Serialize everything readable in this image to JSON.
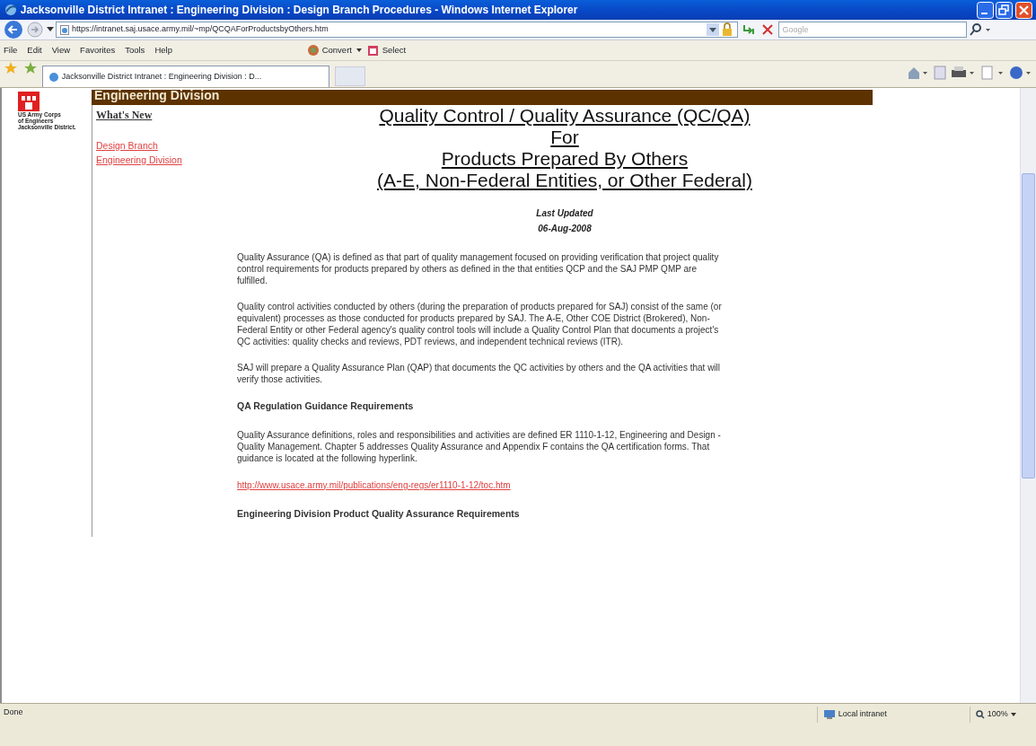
{
  "window": {
    "title": "Jacksonville District Intranet : Engineering Division : Design Branch Procedures - Windows Internet Explorer"
  },
  "address": {
    "url": "https://intranet.saj.usace.army.mil/~mp/QCQAForProductsbyOthers.htm"
  },
  "search": {
    "placeholder": "Google"
  },
  "menu": [
    "File",
    "Edit",
    "View",
    "Favorites",
    "Tools",
    "Help"
  ],
  "toolbar": [
    "Convert",
    "Select"
  ],
  "tabs": [
    {
      "label": "Jacksonville District Intranet : Engineering Division : D...",
      "selected": true
    }
  ],
  "logo": {
    "lines": [
      "US Army Corps",
      "of Engineers",
      "Jacksonville District."
    ]
  },
  "banner": "Engineering Division",
  "sidebar": [
    {
      "label": "What's New",
      "kind": "plain"
    },
    {
      "label": "Design Branch",
      "kind": "red"
    },
    {
      "label": "Engineering Division",
      "kind": "red"
    }
  ],
  "heading": [
    "Quality Control / Quality Assurance (QC/QA)",
    "For",
    "Products Prepared By Others",
    "(A-E, Non-Federal Entities, or Other Federal)"
  ],
  "updated": {
    "label": "Last Updated",
    "date": "06-Aug-2008"
  },
  "body": [
    {
      "kind": "para",
      "text": "Quality Assurance (QA) is defined as that part of quality management focused on providing verification that project quality control requirements for products prepared by others as defined in the that entities QCP and the SAJ PMP QMP are fulfilled."
    },
    {
      "kind": "para",
      "text": "Quality control activities conducted by others (during the preparation of products prepared for SAJ) consist of the same (or equivalent) processes as those conducted for products prepared by SAJ. The A-E, Other COE District (Brokered), Non-Federal Entity or other Federal agency's quality control tools will include a Quality Control Plan that documents a project's QC activities: quality checks and reviews, PDT reviews, and independent technical reviews (ITR)."
    },
    {
      "kind": "para",
      "text": "SAJ will prepare a Quality Assurance Plan (QAP) that documents the QC activities by others and the QA activities that will verify those activities."
    },
    {
      "kind": "heading",
      "text": "QA Regulation Guidance Requirements"
    },
    {
      "kind": "para",
      "text": "Quality Assurance definitions, roles and responsibilities and activities are defined ER 1110-1-12, Engineering and Design - Quality Management. Chapter 5 addresses Quality Assurance and Appendix F contains the QA certification forms. That guidance is located at the following hyperlink."
    },
    {
      "kind": "link",
      "text": "http://www.usace.army.mil/publications/eng-regs/er1110-1-12/toc.htm"
    },
    {
      "kind": "heading",
      "text": "Engineering Division Product Quality Assurance Requirements"
    }
  ],
  "status_bar": {
    "status": "Done",
    "zone": "Local intranet",
    "zoom": "100%"
  }
}
